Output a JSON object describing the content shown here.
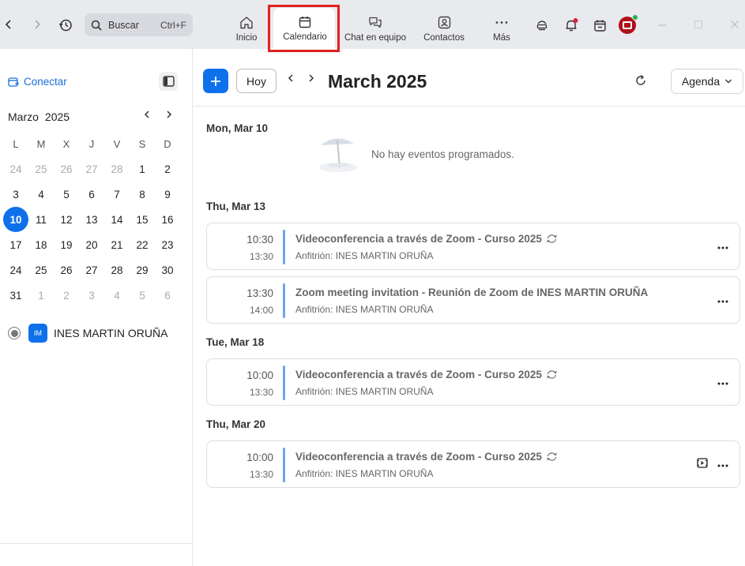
{
  "topbar": {
    "back_icon": "chevron-left-icon",
    "forward_icon": "chevron-right-icon",
    "history_icon": "history-icon",
    "search": {
      "placeholder": "Buscar",
      "shortcut": "Ctrl+F"
    },
    "tabs": [
      {
        "label": "Inicio",
        "icon": "home-icon"
      },
      {
        "label": "Calendario",
        "icon": "calendar-icon",
        "active": true
      },
      {
        "label": "Chat en equipo",
        "icon": "chat-icon"
      },
      {
        "label": "Contactos",
        "icon": "contacts-icon"
      },
      {
        "label": "Más",
        "icon": "more-icon"
      }
    ],
    "highlight_color": "#e02020"
  },
  "sidebar": {
    "connect_label": "Conectar",
    "month_name": "Marzo",
    "year": "2025",
    "weekdays": [
      "L",
      "M",
      "X",
      "J",
      "V",
      "S",
      "D"
    ],
    "weeks": [
      [
        {
          "d": "24",
          "o": 1
        },
        {
          "d": "25",
          "o": 1
        },
        {
          "d": "26",
          "o": 1
        },
        {
          "d": "27",
          "o": 1
        },
        {
          "d": "28",
          "o": 1
        },
        {
          "d": "1"
        },
        {
          "d": "2"
        }
      ],
      [
        {
          "d": "3"
        },
        {
          "d": "4"
        },
        {
          "d": "5"
        },
        {
          "d": "6"
        },
        {
          "d": "7"
        },
        {
          "d": "8"
        },
        {
          "d": "9"
        }
      ],
      [
        {
          "d": "10",
          "t": 1
        },
        {
          "d": "11"
        },
        {
          "d": "12"
        },
        {
          "d": "13"
        },
        {
          "d": "14"
        },
        {
          "d": "15"
        },
        {
          "d": "16"
        }
      ],
      [
        {
          "d": "17"
        },
        {
          "d": "18"
        },
        {
          "d": "19"
        },
        {
          "d": "20"
        },
        {
          "d": "21"
        },
        {
          "d": "22"
        },
        {
          "d": "23"
        }
      ],
      [
        {
          "d": "24"
        },
        {
          "d": "25"
        },
        {
          "d": "26"
        },
        {
          "d": "27"
        },
        {
          "d": "28"
        },
        {
          "d": "29"
        },
        {
          "d": "30"
        }
      ],
      [
        {
          "d": "31"
        },
        {
          "d": "1",
          "o": 1
        },
        {
          "d": "2",
          "o": 1
        },
        {
          "d": "3",
          "o": 1
        },
        {
          "d": "4",
          "o": 1
        },
        {
          "d": "5",
          "o": 1
        },
        {
          "d": "6",
          "o": 1
        }
      ]
    ],
    "user": {
      "initials": "IM",
      "name": "INES MARTIN ORUÑA"
    }
  },
  "main": {
    "title": "March 2025",
    "today_label": "Hoy",
    "view_label": "Agenda",
    "days": [
      {
        "header": "Mon, Mar 10",
        "empty_text": "No hay eventos programados.",
        "events": []
      },
      {
        "header": "Thu, Mar 13",
        "events": [
          {
            "start": "10:30",
            "end": "13:30",
            "title": "Videoconferencia a través de Zoom - Curso 2025",
            "recurring": true,
            "host": "Anfitrión: INES MARTIN ORUÑA"
          },
          {
            "start": "13:30",
            "end": "14:00",
            "title": "Zoom meeting invitation - Reunión de Zoom de INES MARTIN ORUÑA",
            "recurring": false,
            "host": "Anfitrión: INES MARTIN ORUÑA"
          }
        ]
      },
      {
        "header": "Tue, Mar 18",
        "events": [
          {
            "start": "10:00",
            "end": "13:30",
            "title": "Videoconferencia a través de Zoom - Curso 2025",
            "recurring": true,
            "host": "Anfitrión: INES MARTIN ORUÑA"
          }
        ]
      },
      {
        "header": "Thu, Mar 20",
        "events": [
          {
            "start": "10:00",
            "end": "13:30",
            "title": "Videoconferencia a través de Zoom - Curso 2025",
            "recurring": true,
            "host": "Anfitrión: INES MARTIN ORUÑA",
            "has_video_button": true
          }
        ]
      }
    ],
    "accent_color": "#0e71eb",
    "event_bar_color": "#6fa4ea"
  }
}
